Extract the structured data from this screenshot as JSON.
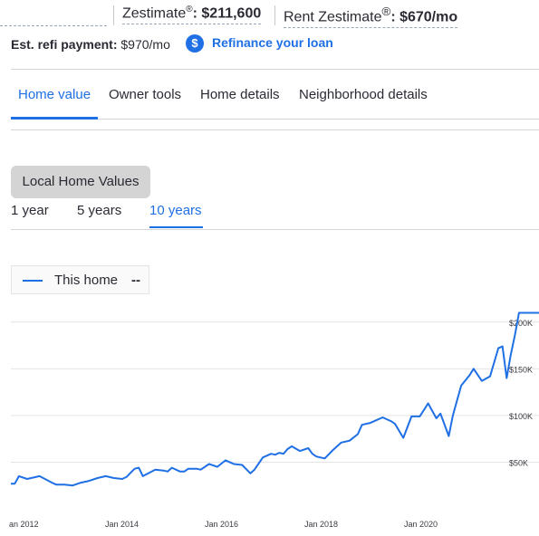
{
  "header": {
    "zestimate_label": "Zestimate",
    "zestimate_reg": "®",
    "zestimate_value": ": $211,600",
    "rent_label": "Rent Zestimate",
    "rent_reg": "®",
    "rent_value": ": $670/mo",
    "refi_label": "Est. refi payment:",
    "refi_value": "$970/mo",
    "dollar_glyph": "$",
    "refi_link": "Refinance your loan"
  },
  "tabs": [
    {
      "label": "Home value",
      "active": true
    },
    {
      "label": "Owner tools"
    },
    {
      "label": "Home details"
    },
    {
      "label": "Neighborhood details"
    }
  ],
  "chart_section": {
    "button_label": "Local Home Values",
    "ranges": [
      {
        "label": "1 year"
      },
      {
        "label": "5 years"
      },
      {
        "label": "10 years",
        "active": true
      }
    ],
    "legend_label": "This home",
    "legend_value": "--"
  },
  "colors": {
    "accent": "#1f6fe5",
    "line": "#1f6fe5",
    "gridline": "#e4e4e4"
  },
  "chart_data": {
    "type": "line",
    "series": [
      {
        "name": "This home",
        "x": [
          "2011-06",
          "2011-09",
          "2011-10",
          "2011-11",
          "2012-01",
          "2012-04",
          "2012-07",
          "2012-08",
          "2012-10",
          "2012-12",
          "2013-02",
          "2013-04",
          "2013-06",
          "2013-08",
          "2013-10",
          "2013-12",
          "2014-01",
          "2014-03",
          "2014-04",
          "2014-05",
          "2014-08",
          "2014-10",
          "2014-11",
          "2014-12",
          "2015-02",
          "2015-03",
          "2015-04",
          "2015-06",
          "2015-07",
          "2015-09",
          "2015-11",
          "2016-01",
          "2016-03",
          "2016-05",
          "2016-07",
          "2016-08",
          "2016-10",
          "2016-12",
          "2017-01",
          "2017-02",
          "2017-03",
          "2017-04",
          "2017-05",
          "2017-07",
          "2017-09",
          "2017-10",
          "2017-11",
          "2018-01",
          "2018-03",
          "2018-05",
          "2018-07",
          "2018-09",
          "2018-10",
          "2018-12",
          "2019-01",
          "2019-03",
          "2019-05",
          "2019-06",
          "2019-08",
          "2019-10",
          "2019-12",
          "2020-02",
          "2020-04",
          "2020-05",
          "2020-07",
          "2020-08",
          "2020-09",
          "2020-10",
          "2020-12",
          "2021-01",
          "2021-03",
          "2021-05",
          "2021-07",
          "2021-08",
          "2021-09",
          "2021-10",
          "2021-11",
          "2021-12",
          "2022-01",
          "2022-02",
          "2022-03",
          "2022-04",
          "2022-05"
        ],
        "values": [
          27000,
          27000,
          27000,
          35000,
          32000,
          35000,
          28000,
          26000,
          26000,
          25000,
          28000,
          30000,
          33000,
          35000,
          33000,
          32000,
          34000,
          43000,
          44000,
          35000,
          42000,
          41000,
          40000,
          44000,
          40000,
          40000,
          43000,
          43000,
          42000,
          48000,
          45000,
          52000,
          48000,
          47000,
          38000,
          42000,
          55000,
          59000,
          58000,
          60000,
          59000,
          64000,
          67000,
          62000,
          65000,
          59000,
          56000,
          54000,
          63000,
          71000,
          73000,
          80000,
          90000,
          92000,
          94000,
          98000,
          94000,
          91000,
          76000,
          99000,
          99000,
          113000,
          97000,
          102000,
          78000,
          100000,
          116000,
          132000,
          143000,
          150000,
          137000,
          142000,
          172000,
          174000,
          140000,
          165000,
          186000,
          210000,
          210000,
          210000,
          210000,
          210000,
          210000
        ],
        "color": "#1f6fe5"
      }
    ],
    "xtick_labels": [
      "an 2012",
      "Jan 2014",
      "Jan 2016",
      "Jan 2018",
      "Jan 2020"
    ],
    "ytick_labels": [
      "$50K",
      "$100K",
      "$150K",
      "$200K"
    ],
    "yticks": [
      50000,
      100000,
      150000,
      200000
    ],
    "ylim": [
      0,
      225000
    ],
    "grid": true
  }
}
